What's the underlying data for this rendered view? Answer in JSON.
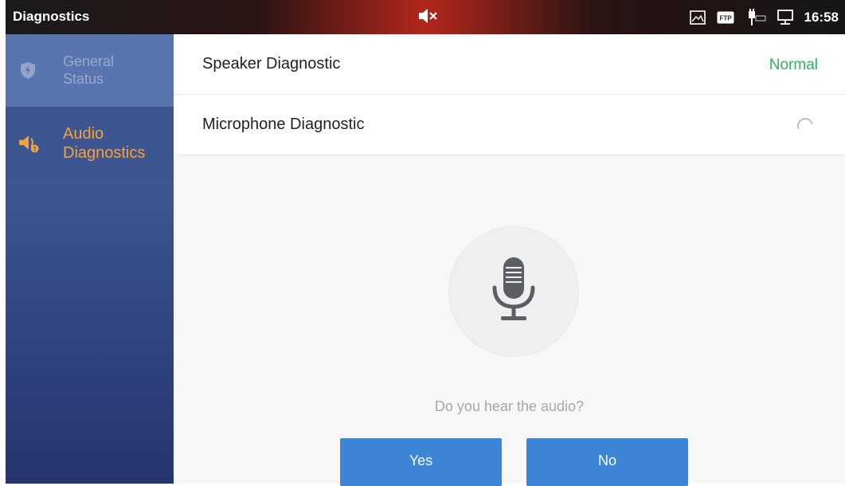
{
  "statusbar": {
    "title": "Diagnostics",
    "time": "16:58",
    "icons": [
      "mute-icon",
      "image-icon",
      "ftp-icon",
      "poe-icon",
      "network-icon"
    ],
    "ftp_label": "FTP"
  },
  "sidebar": {
    "items": [
      {
        "label_line1": "General",
        "label_line2": "Status",
        "icon": "shield-icon"
      },
      {
        "label_line1": "Audio",
        "label_line2": "Diagnostics",
        "icon": "speaker-icon",
        "active": true
      }
    ]
  },
  "main": {
    "rows": [
      {
        "label": "Speaker Diagnostic",
        "status": "Normal"
      },
      {
        "label": "Microphone Diagnostic",
        "status_icon": "loading-spinner-icon"
      }
    ],
    "question": "Do you hear the audio?",
    "yes_label": "Yes",
    "no_label": "No",
    "icon": "microphone-icon"
  },
  "colors": {
    "accent_orange": "#f4a33a",
    "status_green": "#2fb35a",
    "button_blue": "#3d86d7",
    "statusbar_red": "#b3271b"
  }
}
